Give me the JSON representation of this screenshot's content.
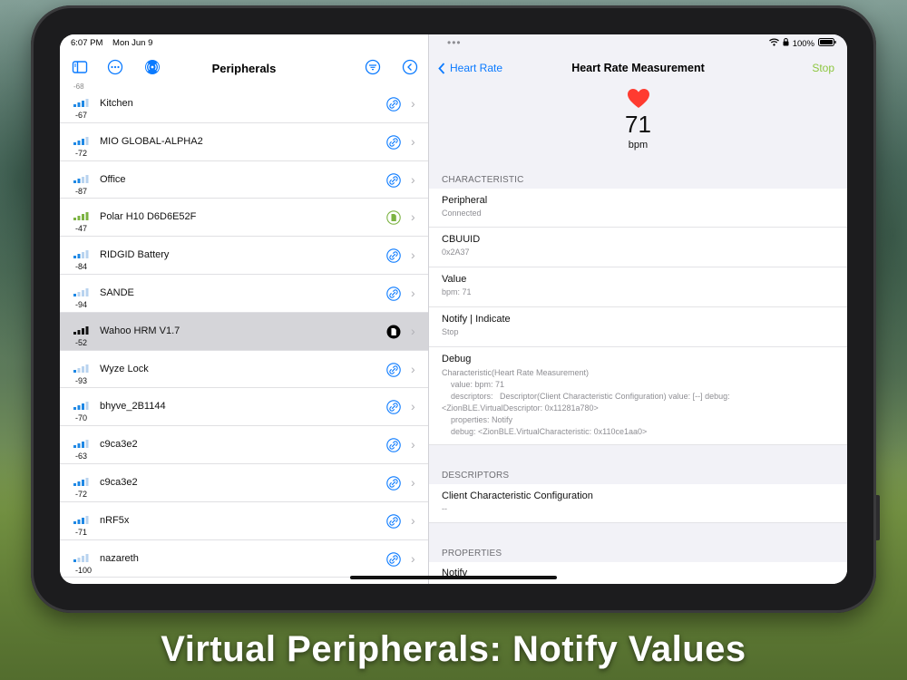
{
  "caption": "Virtual Peripherals: Notify Values",
  "status": {
    "time": "6:07 PM",
    "date": "Mon Jun 9",
    "battery": "100%"
  },
  "left": {
    "title": "Peripherals",
    "top_edge_rssi": "-68",
    "items": [
      {
        "name": "Kitchen",
        "rssi": "-67",
        "bars": 3,
        "badge": "link",
        "selected": false
      },
      {
        "name": "MIO GLOBAL-ALPHA2",
        "rssi": "-72",
        "bars": 3,
        "badge": "link",
        "selected": false
      },
      {
        "name": "Office",
        "rssi": "-87",
        "bars": 2,
        "badge": "link",
        "selected": false
      },
      {
        "name": "Polar H10 D6D6E52F",
        "rssi": "-47",
        "bars": 4,
        "badge": "doc-green",
        "selected": false
      },
      {
        "name": "RIDGID Battery",
        "rssi": "-84",
        "bars": 2,
        "badge": "link",
        "selected": false
      },
      {
        "name": "SANDE",
        "rssi": "-94",
        "bars": 1,
        "badge": "link",
        "selected": false
      },
      {
        "name": "Wahoo HRM V1.7",
        "rssi": "-52",
        "bars": 4,
        "badge": "doc-black",
        "selected": true
      },
      {
        "name": "Wyze Lock",
        "rssi": "-93",
        "bars": 1,
        "badge": "link",
        "selected": false
      },
      {
        "name": "bhyve_2B1144",
        "rssi": "-70",
        "bars": 3,
        "badge": "link",
        "selected": false
      },
      {
        "name": "c9ca3e2",
        "rssi": "-63",
        "bars": 3,
        "badge": "link",
        "selected": false
      },
      {
        "name": "c9ca3e2",
        "rssi": "-72",
        "bars": 3,
        "badge": "link",
        "selected": false
      },
      {
        "name": "nRF5x",
        "rssi": "-71",
        "bars": 3,
        "badge": "link",
        "selected": false
      },
      {
        "name": "nazareth",
        "rssi": "-100",
        "bars": 1,
        "badge": "link",
        "selected": false
      }
    ]
  },
  "right": {
    "back_label": "Heart Rate",
    "title": "Heart Rate Measurement",
    "stop_label": "Stop",
    "hr_value": "71",
    "hr_unit": "bpm",
    "characteristic_header": "CHARACTERISTIC",
    "peripheral_label": "Peripheral",
    "peripheral_value": "Connected",
    "cbuuid_label": "CBUUID",
    "cbuuid_value": "0x2A37",
    "value_label": "Value",
    "value_value": "bpm: 71",
    "notify_label": "Notify | Indicate",
    "notify_value": "Stop",
    "debug_label": "Debug",
    "debug_value": "Characteristic(Heart Rate Measurement)\n    value: bpm: 71\n    descriptors:   Descriptor(Client Characteristic Configuration) value: [--] debug:\n<ZionBLE.VirtualDescriptor: 0x11281a780>\n    properties: Notify\n    debug: <ZionBLE.VirtualCharacteristic: 0x110ce1aa0>",
    "descriptors_header": "DESCRIPTORS",
    "descriptor_label": "Client Characteristic Configuration",
    "descriptor_value": "--",
    "properties_header": "PROPERTIES",
    "property_label": "Notify"
  },
  "colors": {
    "accent": "#0a7aff",
    "stop": "#8dc63f",
    "heart": "#ff3b30",
    "signal_blue": "#1e88e5",
    "signal_green": "#7cb342"
  }
}
